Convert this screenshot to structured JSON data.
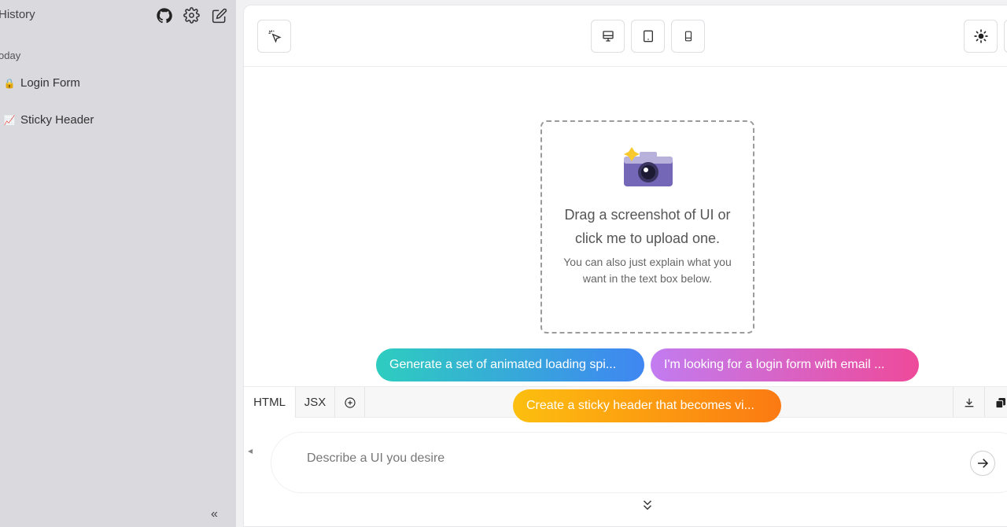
{
  "sidebar": {
    "title": "History",
    "icons": [
      "github-icon",
      "gear-icon",
      "edit-icon"
    ],
    "section_label": "oday",
    "items": [
      {
        "emoji": "🔒",
        "icon": "lock-icon",
        "label": "Login Form"
      },
      {
        "emoji": "📈",
        "icon": "chart-icon",
        "label": "Sticky Header"
      }
    ],
    "collapse_label": "«"
  },
  "toolbar": {
    "select_icon": "pointer-sparkle-icon",
    "devices": [
      "desktop-icon",
      "tablet-icon",
      "mobile-icon"
    ],
    "theme_icon": "sun-icon"
  },
  "dropzone": {
    "main_text": "Drag a screenshot of UI or click me to upload one.",
    "sub_text": "You can also just explain what you want in the text box below.",
    "icon": "camera-icon"
  },
  "suggestions": [
    "Generate a set of animated loading spi...",
    "I'm looking for a login form with email ...",
    "Create a sticky header that becomes vi..."
  ],
  "tabs": {
    "html": "HTML",
    "jsx": "JSX",
    "add_icon": "plus-circle-icon",
    "download_icon": "download-icon",
    "copy_icon": "copy-icon"
  },
  "chat": {
    "placeholder": "Describe a UI you desire",
    "value": "",
    "send_icon": "arrow-right-icon"
  },
  "colors": {
    "sidebar_bg": "#d9d9de",
    "accent_teal": "#2ecdbf",
    "accent_blue": "#3f86f2",
    "accent_purple": "#c27cf0",
    "accent_pink": "#ee4a9a",
    "accent_yellow": "#fcbf0f",
    "accent_orange": "#fb7a12"
  }
}
